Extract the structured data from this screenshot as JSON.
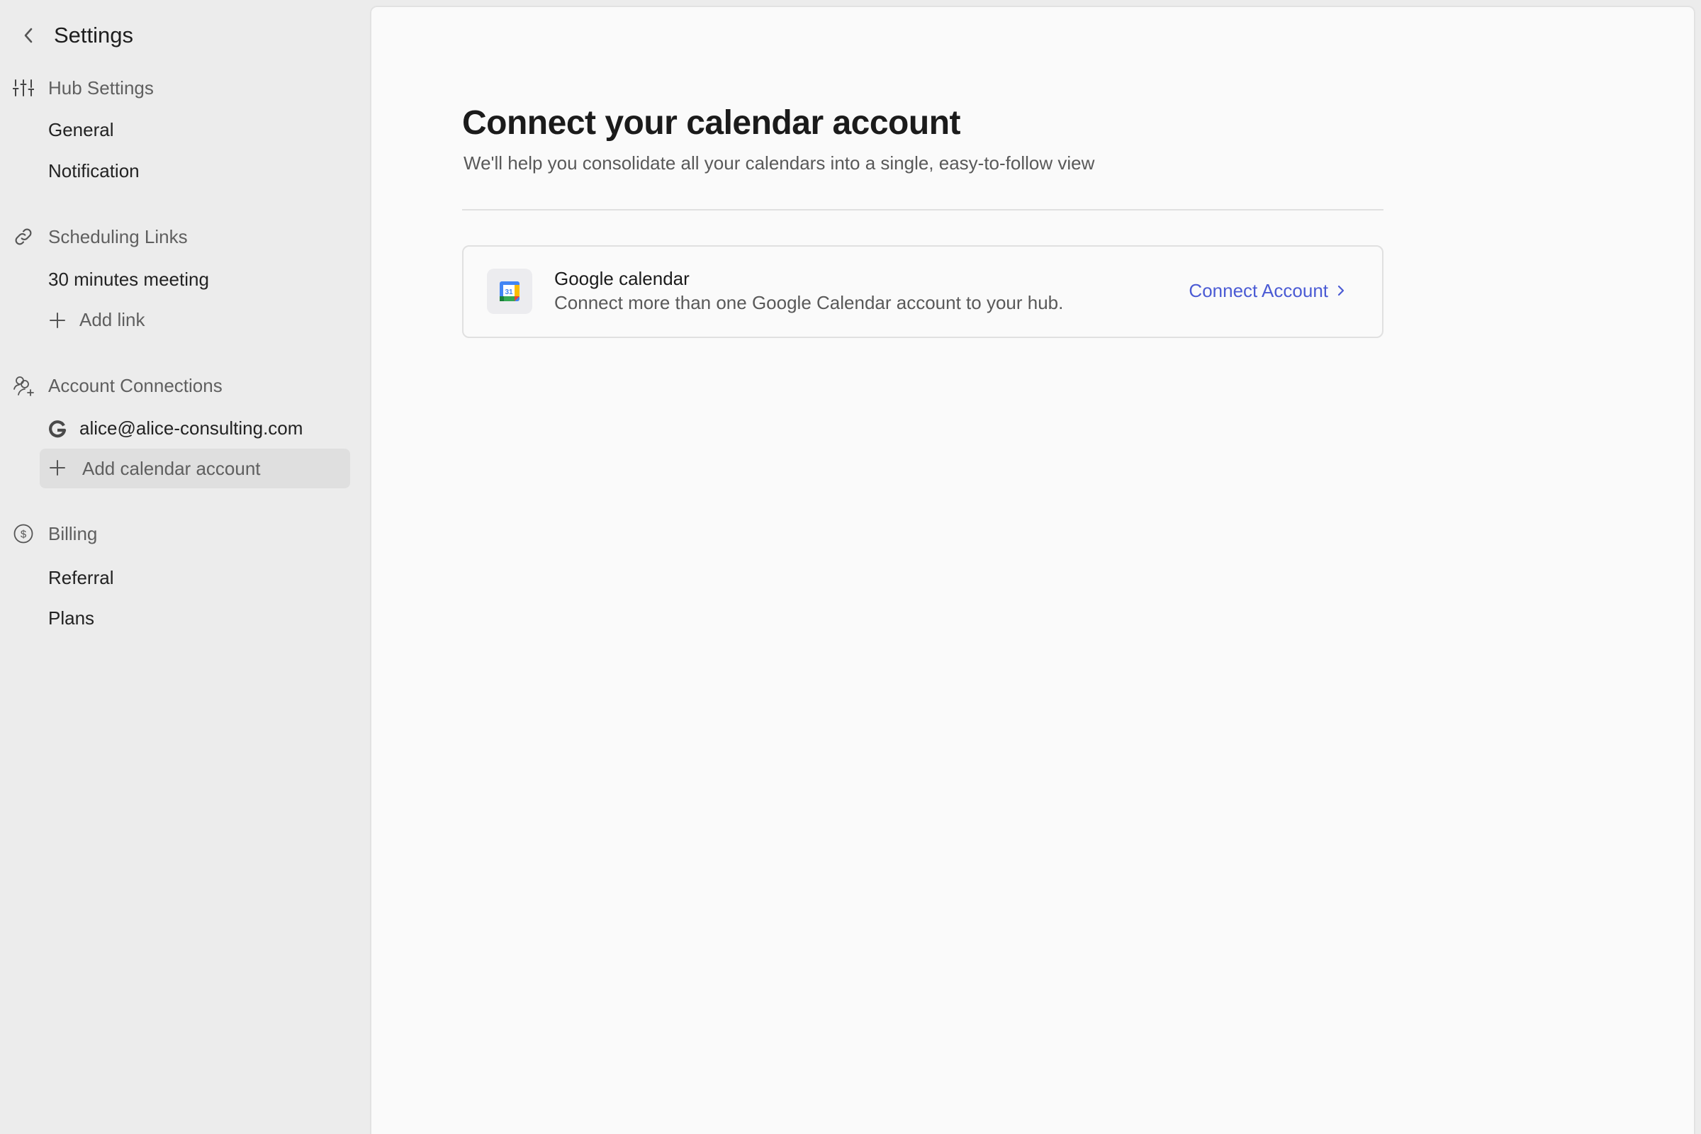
{
  "sidebar": {
    "title": "Settings",
    "sections": [
      {
        "label": "Hub Settings",
        "icon": "sliders-icon",
        "items": [
          {
            "label": "General"
          },
          {
            "label": "Notification"
          }
        ]
      },
      {
        "label": "Scheduling Links",
        "icon": "link-icon",
        "items": [
          {
            "label": "30 minutes meeting"
          },
          {
            "label": "Add link",
            "icon": "plus-icon"
          }
        ]
      },
      {
        "label": "Account Connections",
        "icon": "users-plus-icon",
        "items": [
          {
            "label": "alice@alice-consulting.com",
            "icon": "google-g-icon"
          },
          {
            "label": "Add calendar account",
            "icon": "plus-icon",
            "highlighted": true
          }
        ]
      },
      {
        "label": "Billing",
        "icon": "dollar-circle-icon",
        "items": [
          {
            "label": "Referral"
          },
          {
            "label": "Plans"
          }
        ]
      }
    ]
  },
  "main": {
    "title": "Connect your calendar account",
    "subtitle": "We'll help you consolidate all your calendars into a single, easy-to-follow view",
    "providers": [
      {
        "name": "Google calendar",
        "description": "Connect more than one Google Calendar account to your hub.",
        "icon": "google-calendar-icon",
        "icon_day": "31",
        "action_label": "Connect Account"
      }
    ]
  },
  "colors": {
    "accent": "#4b5bd4",
    "sidebar_bg": "#ececec",
    "panel_bg": "#fafafa",
    "highlight_bg": "#dfdfdf"
  }
}
